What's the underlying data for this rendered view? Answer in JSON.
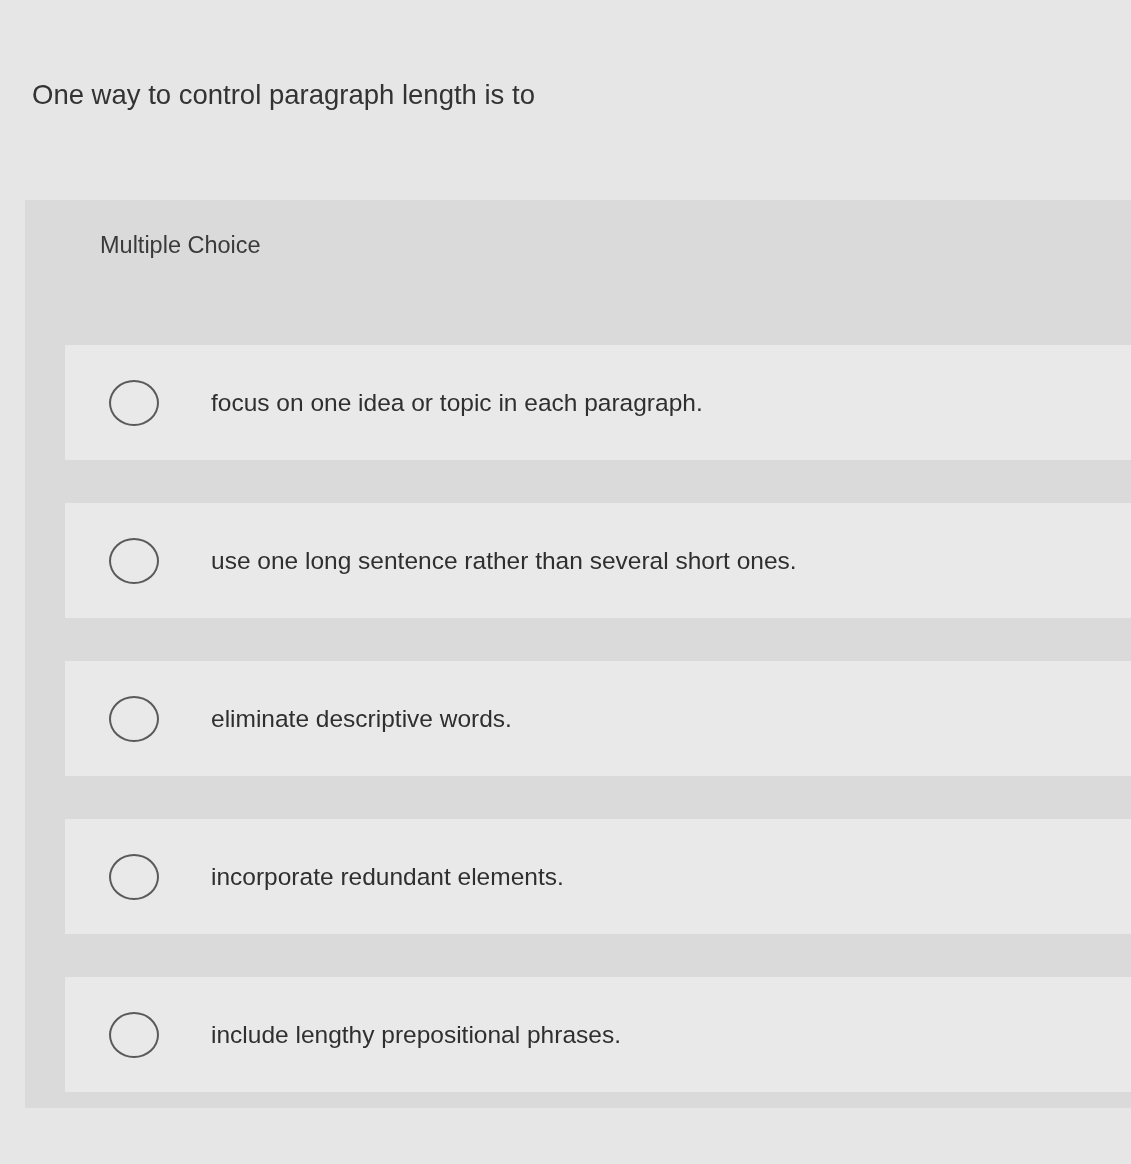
{
  "question": {
    "text": "One way to control paragraph length is to"
  },
  "panel": {
    "label": "Multiple Choice"
  },
  "options": [
    {
      "text": "focus on one idea or topic in each paragraph.",
      "selected": false
    },
    {
      "text": "use one long sentence rather than several short ones.",
      "selected": false
    },
    {
      "text": "eliminate descriptive words.",
      "selected": false
    },
    {
      "text": "incorporate redundant elements.",
      "selected": false
    },
    {
      "text": "include lengthy prepositional phrases.",
      "selected": false
    }
  ]
}
